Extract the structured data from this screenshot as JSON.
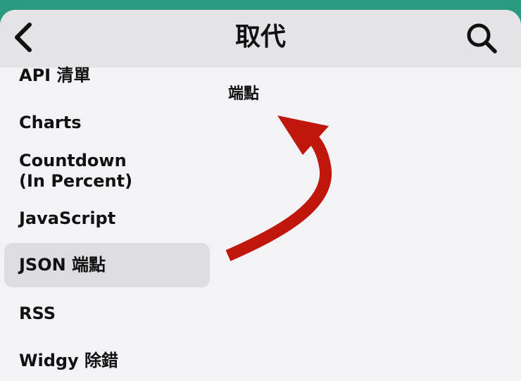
{
  "navbar": {
    "title": "取代",
    "back_icon": "chevron-left-icon",
    "search_icon": "magnifying-glass-icon"
  },
  "sidebar": {
    "items": [
      {
        "label": "API 清單",
        "selected": false
      },
      {
        "label": "Charts",
        "selected": false
      },
      {
        "label": "Countdown\n(In Percent)",
        "selected": false
      },
      {
        "label": "JavaScript",
        "selected": false
      },
      {
        "label": "JSON 端點",
        "selected": true
      },
      {
        "label": "RSS",
        "selected": false
      },
      {
        "label": "Widgy 除錯",
        "selected": false
      }
    ]
  },
  "content": {
    "label": "端點"
  },
  "annotation": {
    "icon": "curved-arrow-annotation",
    "color": "#c0160c"
  },
  "colors": {
    "accent_top": "#2a9b7e",
    "navbar": "#e4e4e8",
    "background": "#f2f2f7",
    "selected_row": "#dcdce1"
  }
}
